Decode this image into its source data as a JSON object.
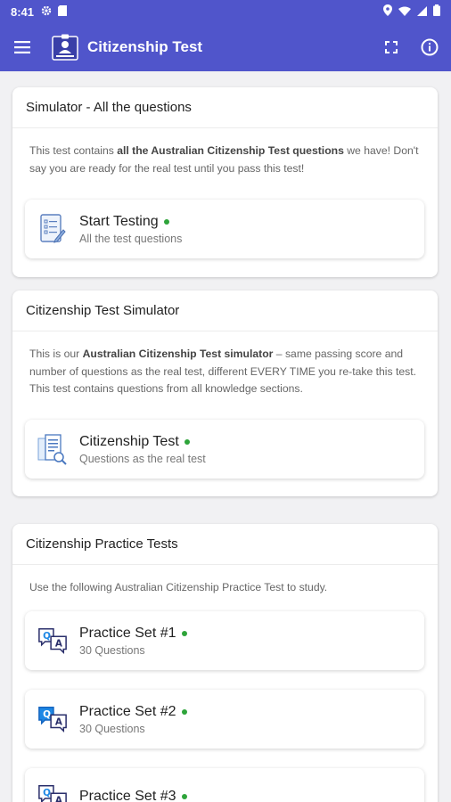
{
  "status": {
    "time": "8:41"
  },
  "app": {
    "title": "Citizenship Test"
  },
  "colors": {
    "primary": "#5055cb",
    "dot": "#2ea43a"
  },
  "icons": [
    "menu-icon",
    "app-logo-icon",
    "fullscreen-icon",
    "info-icon",
    "checklist-icon",
    "test-sheet-icon",
    "qa-icon"
  ],
  "sections": [
    {
      "title": "Simulator - All the questions",
      "desc_pre": "This test contains ",
      "desc_bold": "all the Australian Citizenship Test questions",
      "desc_post": " we have! Don't say you are ready for the real test until you pass this test!",
      "items": [
        {
          "label": "Start Testing",
          "sub": "All the test questions"
        }
      ]
    },
    {
      "title": "Citizenship Test Simulator",
      "desc_pre": "This is our ",
      "desc_bold": "Australian Citizenship Test simulator",
      "desc_post": " – same passing score and number of questions as the real test, different EVERY TIME you re-take this test. This test contains questions from all knowledge sections.",
      "items": [
        {
          "label": "Citizenship Test",
          "sub": "Questions as the real test"
        }
      ]
    },
    {
      "title": "Citizenship Practice Tests",
      "desc": "Use the following Australian Citizenship Practice Test to study.",
      "items": [
        {
          "label": "Practice Set #1",
          "sub": "30 Questions"
        },
        {
          "label": "Practice Set #2",
          "sub": "30 Questions"
        },
        {
          "label": "Practice Set #3",
          "sub": ""
        }
      ]
    }
  ]
}
